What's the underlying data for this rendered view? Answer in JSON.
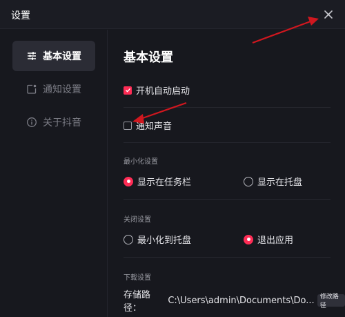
{
  "window": {
    "title": "设置"
  },
  "sidebar": {
    "items": [
      {
        "label": "基本设置",
        "icon": "sliders-icon",
        "active": true
      },
      {
        "label": "通知设置",
        "icon": "notification-icon",
        "active": false
      },
      {
        "label": "关于抖音",
        "icon": "info-icon",
        "active": false
      }
    ]
  },
  "main": {
    "section_title": "基本设置",
    "autostart": {
      "label": "开机自动启动",
      "checked": true
    },
    "notify_sound": {
      "label": "通知声音",
      "checked": false
    },
    "minimize": {
      "label": "最小化设置",
      "options": [
        {
          "label": "显示在任务栏",
          "selected": true
        },
        {
          "label": "显示在托盘",
          "selected": false
        }
      ]
    },
    "close": {
      "label": "关闭设置",
      "options": [
        {
          "label": "最小化到托盘",
          "selected": false
        },
        {
          "label": "退出应用",
          "selected": true
        }
      ]
    },
    "download": {
      "label": "下载设置",
      "path_label": "存储路径：",
      "path_value": "C:\\Users\\admin\\Documents\\Do...",
      "modify_button": "修改路径"
    }
  },
  "colors": {
    "accent": "#fe2c55",
    "background": "#17181e",
    "annotation_arrow": "#d0171f"
  }
}
